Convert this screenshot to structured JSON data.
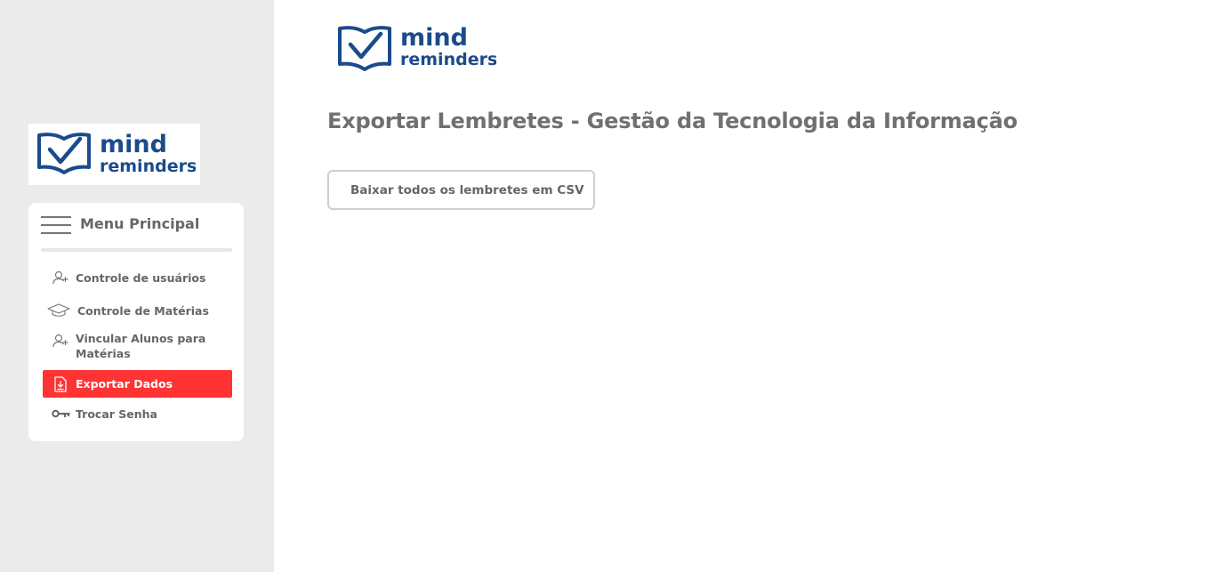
{
  "brand": {
    "line1": "mind",
    "line2": "reminders",
    "color": "#1a4b8c"
  },
  "sidebar": {
    "menu_title": "Menu Principal",
    "items": [
      {
        "label": "Controle de usuários",
        "icon": "add-user-icon",
        "active": false
      },
      {
        "label": "Controle de Matérias",
        "icon": "graduation-cap-icon",
        "active": false
      },
      {
        "label": "Vincular Alunos para Matérias",
        "icon": "add-user-icon",
        "active": false
      },
      {
        "label": "Exportar Dados",
        "icon": "download-file-icon",
        "active": true
      },
      {
        "label": "Trocar Senha",
        "icon": "key-icon",
        "active": false
      }
    ],
    "active_color": "#ff3333"
  },
  "main": {
    "title": "Exportar Lembretes - Gestão da Tecnologia da Informação",
    "csv_button_label": "Baixar todos os lembretes em CSV"
  }
}
